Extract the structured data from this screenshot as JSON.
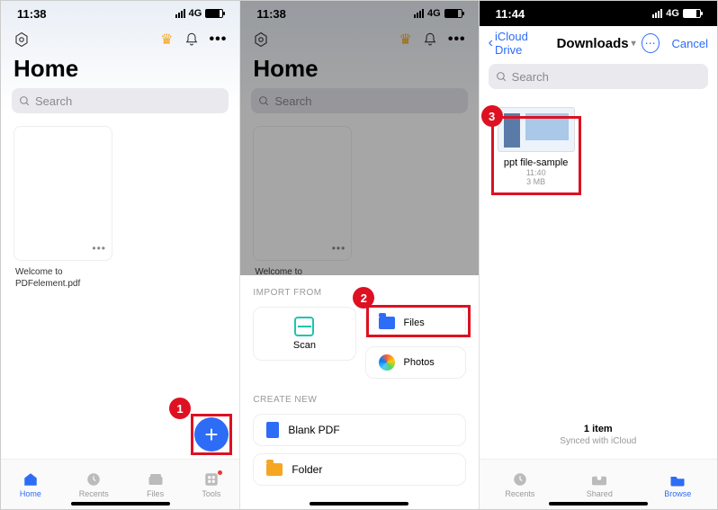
{
  "statusbar": {
    "time_38": "11:38",
    "time_44": "11:44",
    "net": "4G"
  },
  "p1": {
    "title": "Home",
    "search_placeholder": "Search",
    "file1": "Welcome to PDFelement.pdf",
    "tabs": {
      "home": "Home",
      "recents": "Recents",
      "files": "Files",
      "tools": "Tools"
    }
  },
  "p2": {
    "title": "Home",
    "search_placeholder": "Search",
    "file1": "Welcome to PDFelement.pdf",
    "import_label": "IMPORT FROM",
    "create_label": "CREATE NEW",
    "scan": "Scan",
    "files": "Files",
    "photos": "Photos",
    "blank_pdf": "Blank PDF",
    "folder": "Folder"
  },
  "p3": {
    "back": "iCloud Drive",
    "location": "Downloads",
    "cancel": "Cancel",
    "search_placeholder": "Search",
    "file_name": "ppt file-sample",
    "file_time": "11:40",
    "file_size": "3 MB",
    "count": "1 item",
    "sync": "Synced with iCloud",
    "tabs": {
      "recents": "Recents",
      "shared": "Shared",
      "browse": "Browse"
    }
  },
  "steps": {
    "s1": "1",
    "s2": "2",
    "s3": "3"
  }
}
